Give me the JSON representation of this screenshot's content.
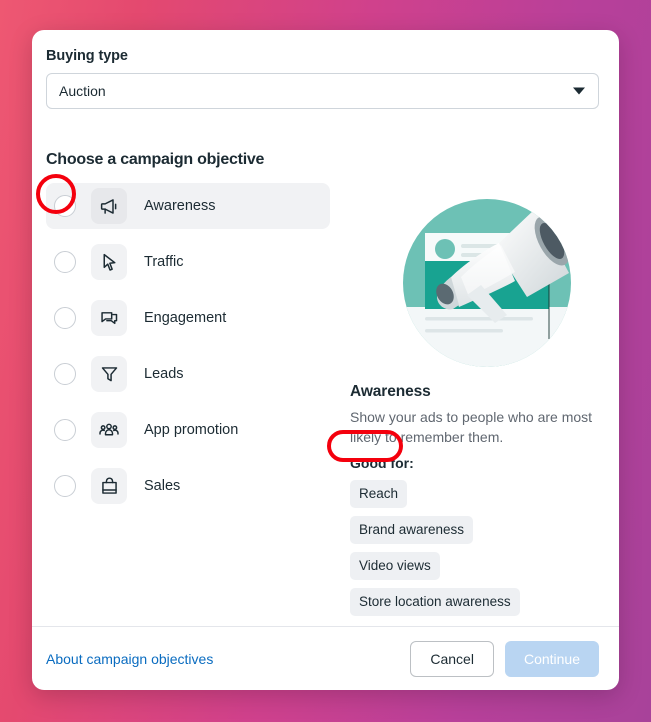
{
  "dialog": {
    "buying_type": {
      "label": "Buying type",
      "value": "Auction",
      "caret_icon": "chevron-down-icon"
    },
    "section_title": "Choose a campaign objective",
    "objectives": [
      {
        "label": "Awareness",
        "icon": "megaphone-icon",
        "selected": true
      },
      {
        "label": "Traffic",
        "icon": "cursor-icon",
        "selected": false
      },
      {
        "label": "Engagement",
        "icon": "chat-bubbles-icon",
        "selected": false
      },
      {
        "label": "Leads",
        "icon": "funnel-icon",
        "selected": false
      },
      {
        "label": "App promotion",
        "icon": "people-group-icon",
        "selected": false
      },
      {
        "label": "Sales",
        "icon": "shopping-bag-icon",
        "selected": false
      }
    ],
    "detail": {
      "illustration": "megaphone-illustration",
      "title": "Awareness",
      "description": "Show your ads to people who are most likely to remember them.",
      "good_for_label": "Good for:",
      "tags": [
        "Reach",
        "Brand awareness",
        "Video views",
        "Store location awareness"
      ]
    },
    "footer": {
      "link": "About campaign objectives",
      "cancel": "Cancel",
      "continue": "Continue"
    }
  },
  "colors": {
    "background_start": "#ee5872",
    "background_end": "#a8429a",
    "link": "#0a6cc0",
    "continue_disabled": "#b9d5f2",
    "annotation": "#f4000d",
    "illustration_circle": "#6dc1b5",
    "illustration_accent": "#14a08d"
  }
}
